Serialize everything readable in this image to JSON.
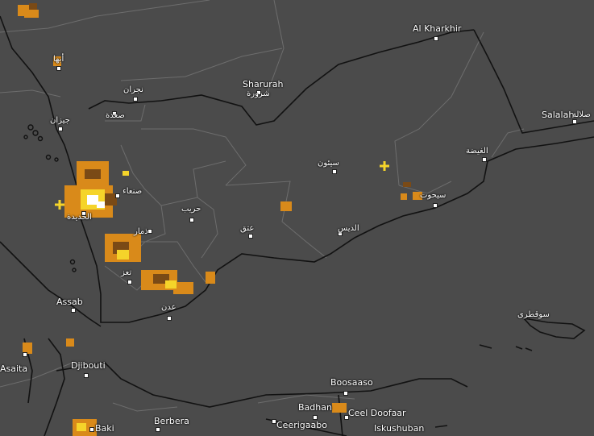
{
  "map": {
    "background": "#4b4b4b",
    "border_color": "#111111",
    "internal_border_color": "#6a6a6a",
    "label_color": "#ffffff",
    "labels": [
      {
        "id": "al-kharkhir",
        "text": "Al Kharkhir"
      },
      {
        "id": "sharurah",
        "text": "Sharurah"
      },
      {
        "id": "sharurah-ar",
        "text": "شرورة"
      },
      {
        "id": "najran-ar",
        "text": "نجران"
      },
      {
        "id": "abha-ar",
        "text": "أبها"
      },
      {
        "id": "jizan-ar",
        "text": "جيزان"
      },
      {
        "id": "saada-ar",
        "text": "صعدة"
      },
      {
        "id": "sanaa-ar",
        "text": "صنعاء"
      },
      {
        "id": "hodeidah-ar",
        "text": "الحديدة"
      },
      {
        "id": "dhamar-ar",
        "text": "ذمار"
      },
      {
        "id": "taiz-ar",
        "text": "تعز"
      },
      {
        "id": "aden-ar",
        "text": "عدن"
      },
      {
        "id": "harib-ar",
        "text": "حريب"
      },
      {
        "id": "ataq-ar",
        "text": "عتق"
      },
      {
        "id": "seiyun-ar",
        "text": "سيئون"
      },
      {
        "id": "alghaydah-ar",
        "text": "الغيضة"
      },
      {
        "id": "sayhut-ar",
        "text": "سيحوت"
      },
      {
        "id": "addis-ar",
        "text": "الديس"
      },
      {
        "id": "salalah",
        "text": "Salalah"
      },
      {
        "id": "salalah-ar",
        "text": "صلالة"
      },
      {
        "id": "socotra-ar",
        "text": "سوقطرى"
      },
      {
        "id": "assab",
        "text": "Assab"
      },
      {
        "id": "asaita",
        "text": "Asaita"
      },
      {
        "id": "djibouti",
        "text": "Djibouti"
      },
      {
        "id": "boosaaso",
        "text": "Boosaaso"
      },
      {
        "id": "badhan",
        "text": "Badhan"
      },
      {
        "id": "ceel-doofaar",
        "text": "Ceel Doofaar"
      },
      {
        "id": "berbera",
        "text": "Berbera"
      },
      {
        "id": "ceerigaabo",
        "text": "Ceerigaabo"
      },
      {
        "id": "iskushuban",
        "text": "Iskushuban"
      },
      {
        "id": "baki",
        "text": "Baki"
      }
    ]
  }
}
